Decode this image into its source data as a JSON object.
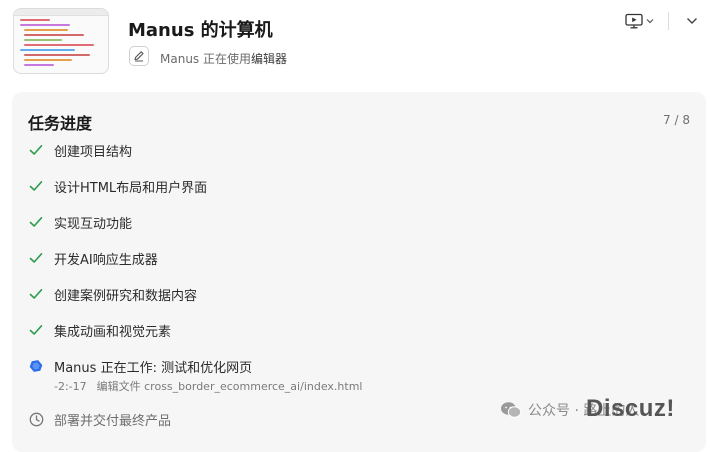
{
  "header": {
    "title": "Manus 的计算机",
    "status_prefix": "Manus 正在使用",
    "status_tool": "编辑器"
  },
  "task_panel": {
    "title": "任务进度",
    "progress": "7 / 8",
    "tasks": [
      {
        "label": "创建项目结构",
        "state": "done"
      },
      {
        "label": "设计HTML布局和用户界面",
        "state": "done"
      },
      {
        "label": "实现互动功能",
        "state": "done"
      },
      {
        "label": "开发AI响应生成器",
        "state": "done"
      },
      {
        "label": "创建案例研究和数据内容",
        "state": "done"
      },
      {
        "label": "集成动画和视觉元素",
        "state": "done"
      },
      {
        "label": "Manus 正在工作: 测试和优化网页",
        "state": "active"
      },
      {
        "label": "部署并交付最终产品",
        "state": "pending"
      }
    ],
    "active_detail": {
      "time": "-2:-17",
      "action": "编辑文件 cross_border_ecommerce_ai/index.html"
    }
  },
  "watermark": {
    "account": "公众号 · 路上的人",
    "brand": "Discuz!"
  },
  "colors": {
    "check": "#2e9d4f",
    "active": "#2b6de8",
    "panel_bg": "#f6f6f6"
  },
  "icons": {
    "done": "check-icon",
    "active": "working-spinner-icon",
    "pending": "clock-icon",
    "screen": "screen-play-icon",
    "chevron": "chevron-down-icon",
    "tool": "pen-edit-icon"
  }
}
